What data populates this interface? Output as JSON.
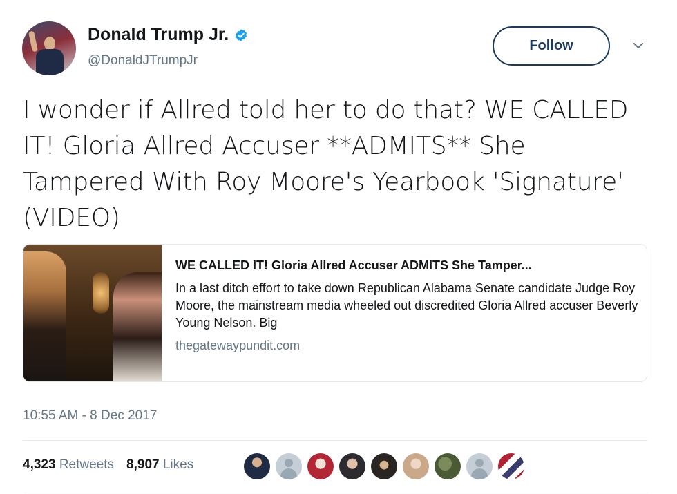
{
  "author": {
    "name": "Donald Trump Jr.",
    "handle": "@DonaldJTrumpJr"
  },
  "follow_label": "Follow",
  "tweet_text": "I wonder if Allred told her to do that? WE CALLED IT! Gloria Allred Accuser **ADMITS** She Tampered With Roy Moore's Yearbook 'Signature' (VIDEO)",
  "card": {
    "title": "WE CALLED IT! Gloria Allred Accuser ADMITS She Tamper...",
    "description": "In a last ditch effort to take down Republican Alabama Senate candidate Judge Roy Moore, the mainstream media wheeled out discredited Gloria Allred accuser Beverly Young Nelson. Big",
    "domain": "thegatewaypundit.com"
  },
  "timestamp": "10:55 AM - 8 Dec 2017",
  "stats": {
    "retweets_count": "4,323",
    "retweets_label": "Retweets",
    "likes_count": "8,907",
    "likes_label": "Likes"
  },
  "icons": {
    "verified": "verified-badge-icon",
    "caret": "chevron-down-icon"
  },
  "colors": {
    "verified_blue": "#1da1f2",
    "follow_border": "#1b3a5c",
    "secondary_text": "#657786"
  }
}
